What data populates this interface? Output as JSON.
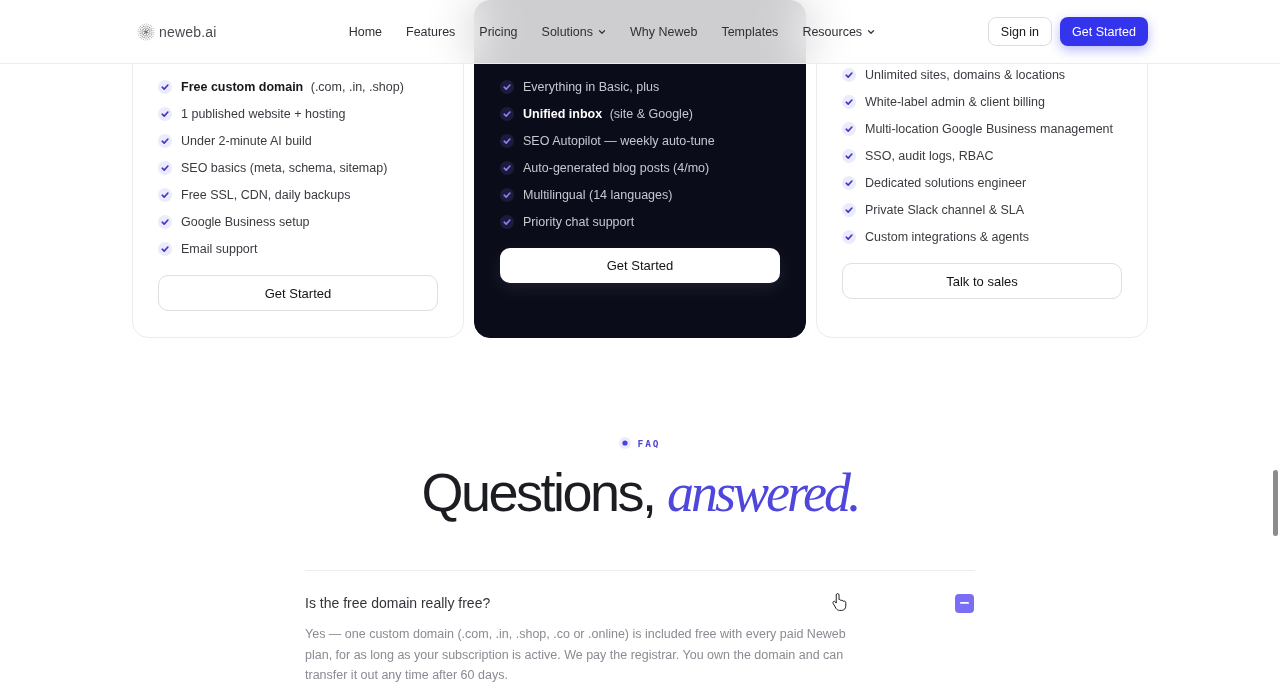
{
  "header": {
    "logo": "neweb.ai",
    "nav": [
      {
        "label": "Home",
        "has_menu": false
      },
      {
        "label": "Features",
        "has_menu": false
      },
      {
        "label": "Pricing",
        "has_menu": false
      },
      {
        "label": "Solutions",
        "has_menu": true
      },
      {
        "label": "Why Neweb",
        "has_menu": false
      },
      {
        "label": "Templates",
        "has_menu": false
      },
      {
        "label": "Resources",
        "has_menu": true
      }
    ],
    "sign_in": "Sign in",
    "cta": "Get Started"
  },
  "plans": [
    {
      "kind": "standard",
      "features": [
        "**Free custom domain** (.com, .in, .shop)",
        "1 published website + hosting",
        "Under 2-minute AI build",
        "SEO basics (meta, schema, sitemap)",
        "Free SSL, CDN, daily backups",
        "Google Business setup",
        "Email support"
      ],
      "button": "Get Started"
    },
    {
      "kind": "featured",
      "features": [
        "Everything in Basic, plus",
        "**Unified inbox** (site & Google)",
        "SEO Autopilot — weekly auto-tune",
        "Auto-generated blog posts (4/mo)",
        "Multilingual (14 languages)",
        "Priority chat support"
      ],
      "button": "Get Started"
    },
    {
      "kind": "standard",
      "features": [
        "Unlimited sites, domains & locations",
        "White-label admin & client billing",
        "Multi-location Google Business management",
        "SSO, audit logs, RBAC",
        "Dedicated solutions engineer",
        "Private Slack channel & SLA",
        "Custom integrations & agents"
      ],
      "button": "Talk to sales"
    }
  ],
  "faq": {
    "eyebrow": "FAQ",
    "heading": "Questions, *answered.*",
    "items": [
      {
        "question": "Is the free domain really free?",
        "expanded": true,
        "answer": "Yes — one custom domain (.com, .in, .shop, .co or .online) is included free with every paid Neweb plan, for as long as your subscription is active. We pay the registrar. You own the domain and can transfer it out any time after 60 days."
      }
    ]
  }
}
